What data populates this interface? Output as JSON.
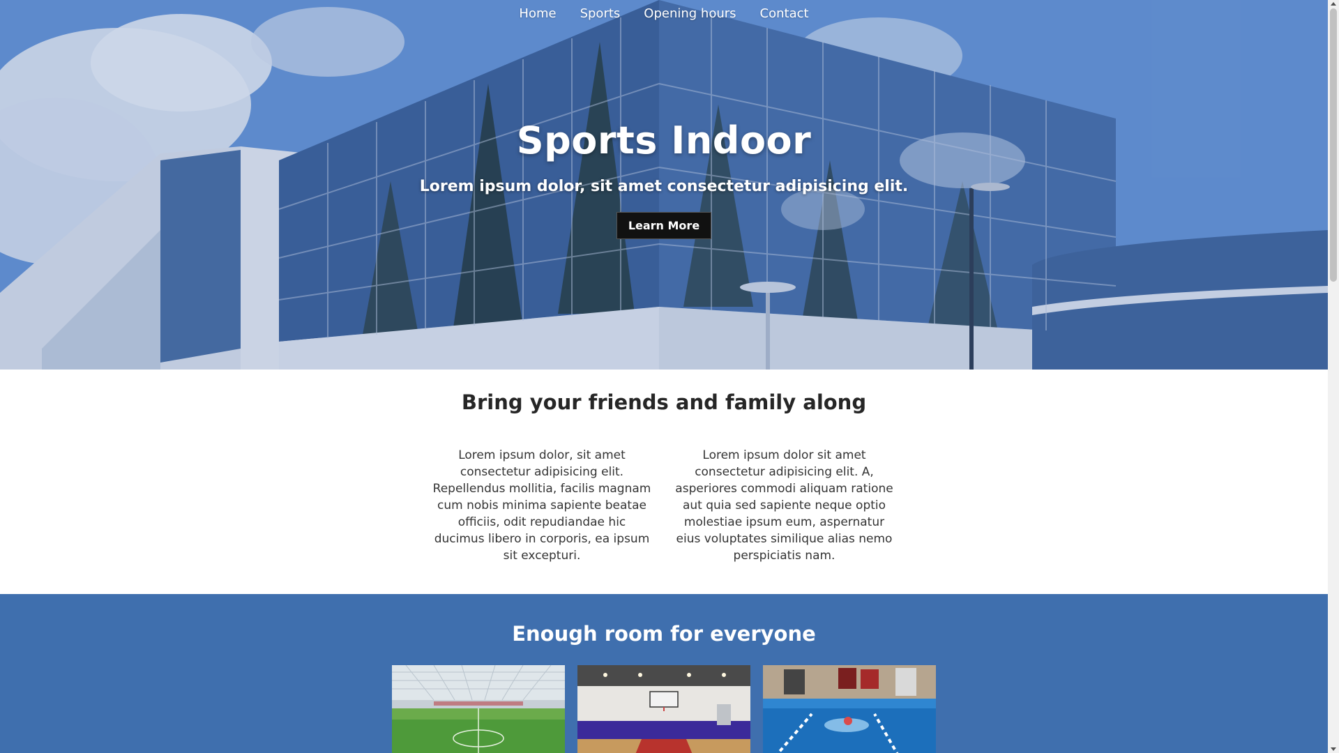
{
  "nav": {
    "items": [
      {
        "label": "Home"
      },
      {
        "label": "Sports"
      },
      {
        "label": "Opening hours"
      },
      {
        "label": "Contact"
      }
    ]
  },
  "hero": {
    "title": "Sports Indoor",
    "subtitle": "Lorem ipsum dolor, sit amet consectetur adipisicing elit.",
    "button_label": "Learn More"
  },
  "friends": {
    "title": "Bring your friends and family along",
    "columns": [
      {
        "text": "Lorem ipsum dolor, sit amet consectetur adipisicing elit. Repellendus mollitia, facilis magnam cum nobis minima sapiente beatae officiis, odit repudiandae hic ducimus libero in corporis, ea ipsum sit excepturi."
      },
      {
        "text": "Lorem ipsum dolor sit amet consectetur adipisicing elit. A, asperiores commodi aliquam ratione aut quia sed sapiente neque optio molestiae ipsum eum, aspernatur eius voluptates similique alias nemo perspiciatis nam."
      }
    ]
  },
  "room": {
    "title": "Enough room for everyone",
    "photos": [
      {
        "name": "indoor-football-field"
      },
      {
        "name": "basketball-court"
      },
      {
        "name": "swimming-pool"
      }
    ]
  },
  "colors": {
    "hero_sky": "#5d8fd3",
    "room_bg": "#3f6fae",
    "button_bg": "#111111",
    "heading_text": "#262626",
    "body_text": "#333333"
  }
}
